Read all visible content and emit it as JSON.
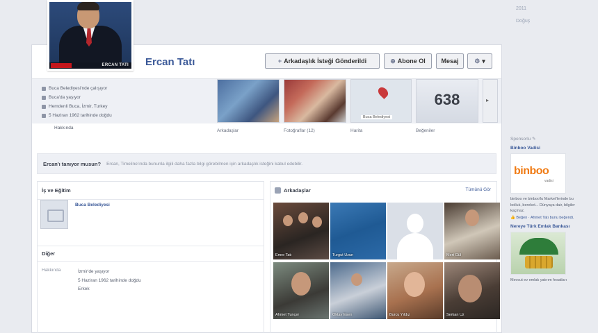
{
  "rail_top": [
    "2011",
    "Doğuş"
  ],
  "profile": {
    "name": "Ercan Tatı",
    "pic_caption": "ERCAN TATI"
  },
  "actions": {
    "friend_request": "Arkadaşlık İsteği Gönderildi",
    "subscribe": "Abone Ol",
    "message": "Mesaj",
    "settings": "▾"
  },
  "info": {
    "items": [
      "Buca Belediyesi'nde çalışıyor",
      "Buca'da yaşıyor",
      "Hemdenli Buca, İzmir, Turkey",
      "5 Haziran 1962 tarihinde doğdu"
    ],
    "more": "Hakkında"
  },
  "sections": {
    "friends_label": "Arkadaşlar",
    "photos_label": "Fotoğraflar (12)",
    "map_label": "Harita",
    "likes_label": "Beğeniler",
    "likes_count": "638",
    "map_place": "Buca Belediyesi",
    "scroll_arrow": "▸"
  },
  "question": {
    "title": "Ercan'ı tanıyor musun?",
    "hint": "Ercan, Timeline'ında bununla ilgili daha fazla bilgi görebilmen için arkadaşlık isteğini kabul edebilir."
  },
  "work": {
    "heading": "İş ve Eğitim",
    "employer": "Buca Belediyesi",
    "other_heading": "Diğer",
    "about_key": "Hakkında",
    "about": [
      "İzmir'de yaşıyor",
      "5 Haziran 1962 tarihinde doğdu",
      "Erkek"
    ]
  },
  "friends_panel": {
    "heading": "Arkadaşlar",
    "see_all": "Tümünü Gör",
    "friends": [
      {
        "name": "Emre Tatı"
      },
      {
        "name": "Turgut Uzun"
      },
      {
        "name": ""
      },
      {
        "name": "Mert Gül"
      },
      {
        "name": "Ahmet Tunçer"
      },
      {
        "name": "Oktay Esen"
      },
      {
        "name": "Burcu Yıldız"
      },
      {
        "name": "Serkan Uz"
      }
    ]
  },
  "ads": {
    "sponsored": "Sponsorlu ✎",
    "ad1_title": "Binboo Vadisi",
    "ad1_logo": "binboo",
    "ad1_logo_sub": "vadisi",
    "ad1_desc": "binboo ve binboo'lu Market'lerinde bu bolluk, bereket... Dünyaya dair, bilgiler kaçmaz.",
    "ad1_like": "👍 Beğen · Ahmet Tatı bunu beğendi.",
    "ad2_title": "Nereye Türk Emlak Bankası",
    "ad2_desc": "Mevcut ev emlak yatırım fırsatları"
  }
}
